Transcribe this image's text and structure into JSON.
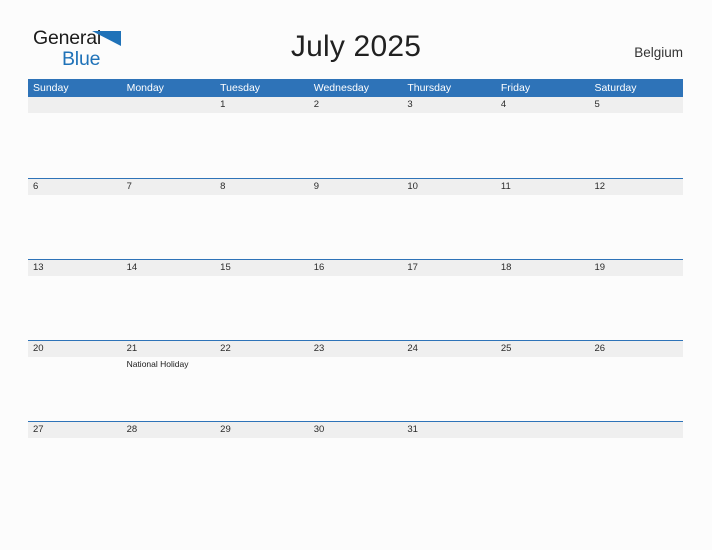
{
  "header": {
    "logo": {
      "text_primary": "General",
      "text_secondary": "Blue",
      "icon": "flag-triangle-icon",
      "color_primary": "#1b1b1b",
      "color_secondary": "#1f72b8"
    },
    "title": "July 2025",
    "country": "Belgium"
  },
  "theme": {
    "header_blue": "#2e73b8",
    "date_band_gray": "#efefef",
    "page_background": "#fcfcfc",
    "text_dark": "#2b2b2b"
  },
  "calendar": {
    "month": "July",
    "year": "2025",
    "weekday_headers": [
      "Sunday",
      "Monday",
      "Tuesday",
      "Wednesday",
      "Thursday",
      "Friday",
      "Saturday"
    ],
    "weeks": [
      [
        {
          "day": ""
        },
        {
          "day": ""
        },
        {
          "day": "1"
        },
        {
          "day": "2"
        },
        {
          "day": "3"
        },
        {
          "day": "4"
        },
        {
          "day": "5"
        }
      ],
      [
        {
          "day": "6"
        },
        {
          "day": "7"
        },
        {
          "day": "8"
        },
        {
          "day": "9"
        },
        {
          "day": "10"
        },
        {
          "day": "11"
        },
        {
          "day": "12"
        }
      ],
      [
        {
          "day": "13"
        },
        {
          "day": "14"
        },
        {
          "day": "15"
        },
        {
          "day": "16"
        },
        {
          "day": "17"
        },
        {
          "day": "18"
        },
        {
          "day": "19"
        }
      ],
      [
        {
          "day": "20"
        },
        {
          "day": "21",
          "event": "National Holiday"
        },
        {
          "day": "22"
        },
        {
          "day": "23"
        },
        {
          "day": "24"
        },
        {
          "day": "25"
        },
        {
          "day": "26"
        }
      ],
      [
        {
          "day": "27"
        },
        {
          "day": "28"
        },
        {
          "day": "29"
        },
        {
          "day": "30"
        },
        {
          "day": "31"
        },
        {
          "day": ""
        },
        {
          "day": ""
        }
      ]
    ]
  }
}
